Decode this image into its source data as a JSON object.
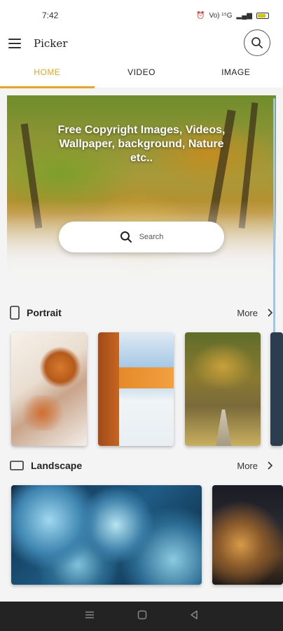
{
  "status_bar": {
    "time": "7:42",
    "signal_text": "Vo) ¹⁵G"
  },
  "app_bar": {
    "title": "Picker"
  },
  "tabs": [
    {
      "label": "HOME",
      "active": true
    },
    {
      "label": "VIDEO",
      "active": false
    },
    {
      "label": "IMAGE",
      "active": false
    }
  ],
  "hero": {
    "headline": "Free Copyright Images, Videos, Wallpaper, background, Nature etc..",
    "search_placeholder": "Search"
  },
  "sections": {
    "portrait": {
      "title": "Portrait",
      "more_label": "More"
    },
    "landscape": {
      "title": "Landscape",
      "more_label": "More"
    }
  },
  "colors": {
    "accent": "#f2a21b",
    "nav_bar": "#232323"
  },
  "icons": {
    "menu": "hamburger-menu-icon",
    "search": "search-icon",
    "portrait": "portrait-phone-icon",
    "landscape": "landscape-screen-icon",
    "chevron": "chevron-right-icon",
    "nav_recents": "recents-icon",
    "nav_home": "home-icon",
    "nav_back": "back-icon"
  }
}
